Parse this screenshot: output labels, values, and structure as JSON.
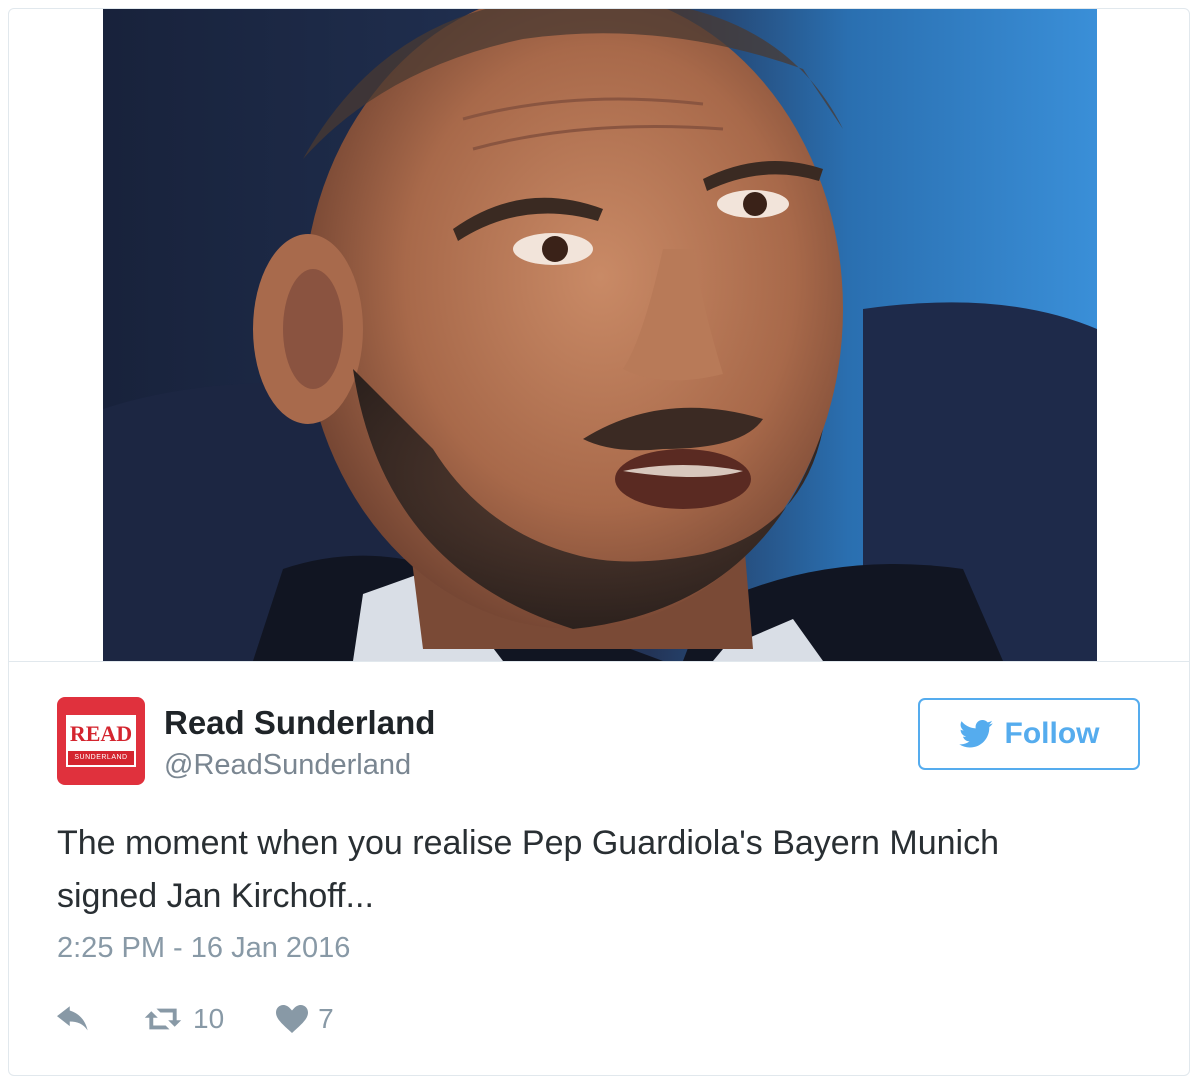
{
  "tweet": {
    "author": {
      "name": "Read Sunderland",
      "handle": "@ReadSunderland",
      "avatar": {
        "logo_text": "READ",
        "logo_subtext": "SUNDERLAND",
        "color": "#e0313d"
      }
    },
    "follow_button": {
      "label": "Follow",
      "icon": "twitter-bird-icon",
      "color": "#55acee"
    },
    "text_line1": "The moment when you realise Pep Guardiola's Bayern Munich",
    "text_line2": "signed Jan Kirchoff...",
    "timestamp": "2:25 PM - 16 Jan 2016",
    "actions": {
      "reply_icon": "reply-icon",
      "retweet_icon": "retweet-icon",
      "retweet_count": "10",
      "like_icon": "heart-icon",
      "like_count": "7"
    }
  }
}
